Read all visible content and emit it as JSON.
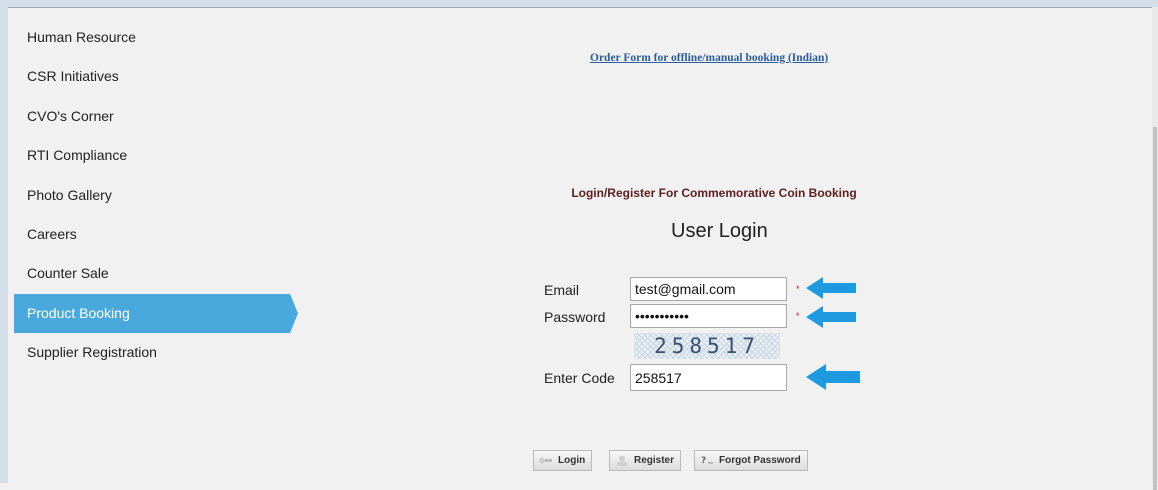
{
  "sidebar": {
    "items": [
      {
        "label": "Human Resource"
      },
      {
        "label": "CSR Initiatives"
      },
      {
        "label": "CVO's Corner"
      },
      {
        "label": "RTI Compliance"
      },
      {
        "label": "Photo Gallery"
      },
      {
        "label": "Careers"
      },
      {
        "label": "Counter Sale"
      },
      {
        "label": "Product Booking",
        "active": true
      },
      {
        "label": "Supplier Registration"
      }
    ]
  },
  "main": {
    "order_link": "Order Form for offline/manual booking (Indian)",
    "coin_heading": "Login/Register For Commemorative Coin Booking",
    "login_title": "User Login"
  },
  "form": {
    "email_label": "Email",
    "email_value": "test@gmail.com",
    "password_label": "Password",
    "password_value": "password123",
    "captcha_text": "258517",
    "code_label": "Enter Code",
    "code_value": "258517",
    "required_mark": "*"
  },
  "buttons": {
    "login": "Login",
    "register": "Register",
    "forgot": "Forgot Password"
  },
  "colors": {
    "accent": "#4aa9dc",
    "arrow": "#1e9be0",
    "heading": "#5e2020",
    "link": "#2a5d9b"
  }
}
